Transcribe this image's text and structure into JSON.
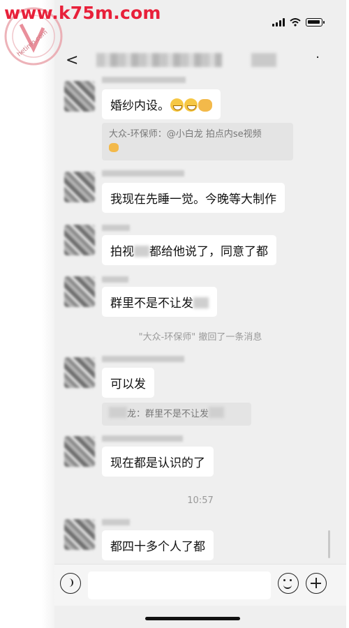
{
  "watermark": {
    "url_text": "www.k75m.com",
    "logo_text": "hetimo.com"
  },
  "status_bar": {
    "icons": [
      "signal-icon",
      "wifi-icon",
      "battery-icon"
    ]
  },
  "nav": {
    "back_glyph": "<",
    "more_glyph": "·"
  },
  "messages": {
    "m1": "婚纱内设。",
    "m1_quote": "大众-环保师：@小白龙 拍点内se视频",
    "m2": "我现在先睡一觉。今晚等大制作",
    "m3_a": "拍视",
    "m3_b": "都给他说了，同意了都",
    "m4": "群里不是不让发",
    "recall_notice": "\"大众-环保师\" 撤回了一条消息",
    "m5": "可以发",
    "m5_quote_a": "龙：群里不是不让发",
    "m6": "现在都是认识的了",
    "time": "10:57",
    "m7": "都四十多个人了都"
  },
  "input_bar": {
    "placeholder": ""
  }
}
